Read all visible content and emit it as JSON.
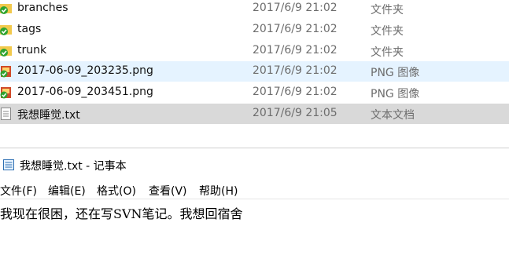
{
  "explorer": {
    "rows": [
      {
        "name": "branches",
        "date": "2017/6/9 21:02",
        "type": "文件夹",
        "icon": "svn-folder-icon"
      },
      {
        "name": "tags",
        "date": "2017/6/9 21:02",
        "type": "文件夹",
        "icon": "svn-folder-icon"
      },
      {
        "name": "trunk",
        "date": "2017/6/9 21:02",
        "type": "文件夹",
        "icon": "svn-folder-icon"
      },
      {
        "name": "2017-06-09_203235.png",
        "date": "2017/6/9 21:02",
        "type": "PNG 图像",
        "icon": "svn-image-icon"
      },
      {
        "name": "2017-06-09_203451.png",
        "date": "2017/6/9 21:02",
        "type": "PNG 图像",
        "icon": "svn-image-icon"
      },
      {
        "name": "我想睡觉.txt",
        "date": "2017/6/9 21:05",
        "type": "文本文档",
        "icon": "text-file-icon"
      }
    ]
  },
  "notepad": {
    "title": "我想睡觉.txt - 记事本",
    "menu": [
      "文件(F)",
      "编辑(E)",
      "格式(O)",
      "查看(V)",
      "帮助(H)"
    ],
    "content": "我现在很困，还在写SVN笔记。我想回宿舍"
  },
  "colors": {
    "hover_row": "#e5f3ff",
    "selected_row": "#d9d9d9",
    "svn_ok_green": "#2fa32f",
    "folder_yellow": "#f2c94c"
  }
}
